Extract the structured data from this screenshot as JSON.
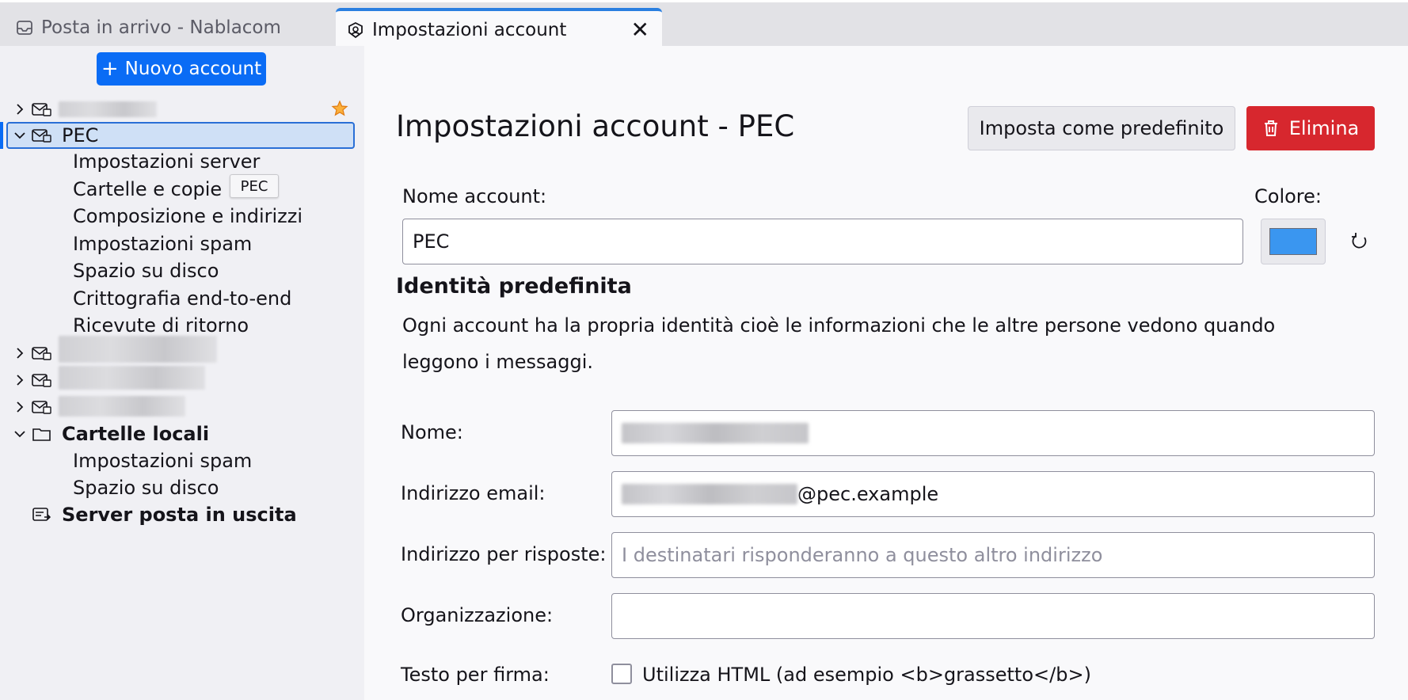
{
  "tabs": [
    {
      "label": "Posta in arrivo - Nablacom",
      "icon": "inbox-icon"
    },
    {
      "label": "Impostazioni account",
      "icon": "account-settings-icon",
      "close": "✕"
    }
  ],
  "sidebar": {
    "new_account_label": "Nuovo account",
    "new_account_plus": "+",
    "pec_account": {
      "label": "PEC",
      "tooltip": "PEC",
      "children": [
        "Impostazioni server",
        "Cartelle e copie",
        "Composizione e indirizzi",
        "Impostazioni spam",
        "Spazio su disco",
        "Crittografia end-to-end",
        "Ricevute di ritorno"
      ]
    },
    "local_folders": {
      "label": "Cartelle locali",
      "children": [
        "Impostazioni spam",
        "Spazio su disco"
      ]
    },
    "outgoing_server_label": "Server posta in uscita"
  },
  "main": {
    "title": "Impostazioni account - PEC",
    "set_default_label": "Imposta come predefinito",
    "delete_label": "Elimina",
    "account_name_label": "Nome account:",
    "account_name_value": "PEC",
    "color_label": "Colore:",
    "account_color": "#3a96f0",
    "identity_title": "Identità predefinita",
    "identity_desc": "Ogni account ha la propria identità cioè le informazioni che le altre persone vedono quando leggono i messaggi.",
    "name_label": "Nome:",
    "email_label": "Indirizzo email:",
    "email_domain": "@pec.example",
    "reply_to_label": "Indirizzo per risposte:",
    "reply_to_placeholder": "I destinatari risponderanno a questo altro indirizzo",
    "org_label": "Organizzazione:",
    "signature_label": "Testo per firma:",
    "use_html_label": "Utilizza HTML (ad esempio <b>grassetto</b>)"
  },
  "colors": {
    "accent": "#0a6cf5",
    "danger": "#d7272e",
    "selection": "#cfe0f6"
  }
}
